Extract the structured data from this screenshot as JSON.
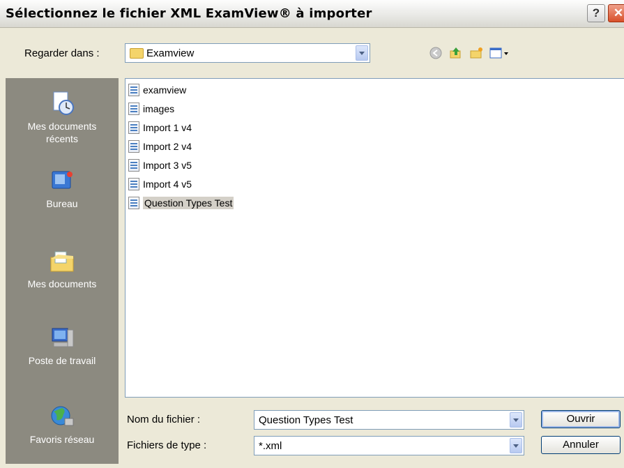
{
  "window": {
    "title": "Sélectionnez le fichier XML ExamView® à importer"
  },
  "titlebar": {
    "help_label": "?",
    "close_label": "✕"
  },
  "lookin": {
    "label": "Regarder dans :",
    "value": "Examview"
  },
  "places": [
    {
      "label": "Mes documents récents",
      "icon": "recent-documents-icon"
    },
    {
      "label": "Bureau",
      "icon": "desktop-icon"
    },
    {
      "label": "Mes documents",
      "icon": "my-documents-icon"
    },
    {
      "label": "Poste de travail",
      "icon": "my-computer-icon"
    },
    {
      "label": "Favoris réseau",
      "icon": "network-places-icon"
    }
  ],
  "files": [
    "examview",
    "images",
    "Import 1 v4",
    "Import 2 v4",
    "Import 3 v5",
    "Import 4 v5",
    "Question Types Test"
  ],
  "selected_file": "Question Types Test",
  "filename": {
    "label": "Nom du fichier :",
    "value": "Question Types Test"
  },
  "filetype": {
    "label": "Fichiers de type :",
    "value": "*.xml"
  },
  "buttons": {
    "open": "Ouvrir",
    "cancel": "Annuler"
  },
  "colors": {
    "places_bg": "#8c8a80",
    "dialog_bg": "#ece9d8",
    "input_border": "#7f9db9"
  }
}
